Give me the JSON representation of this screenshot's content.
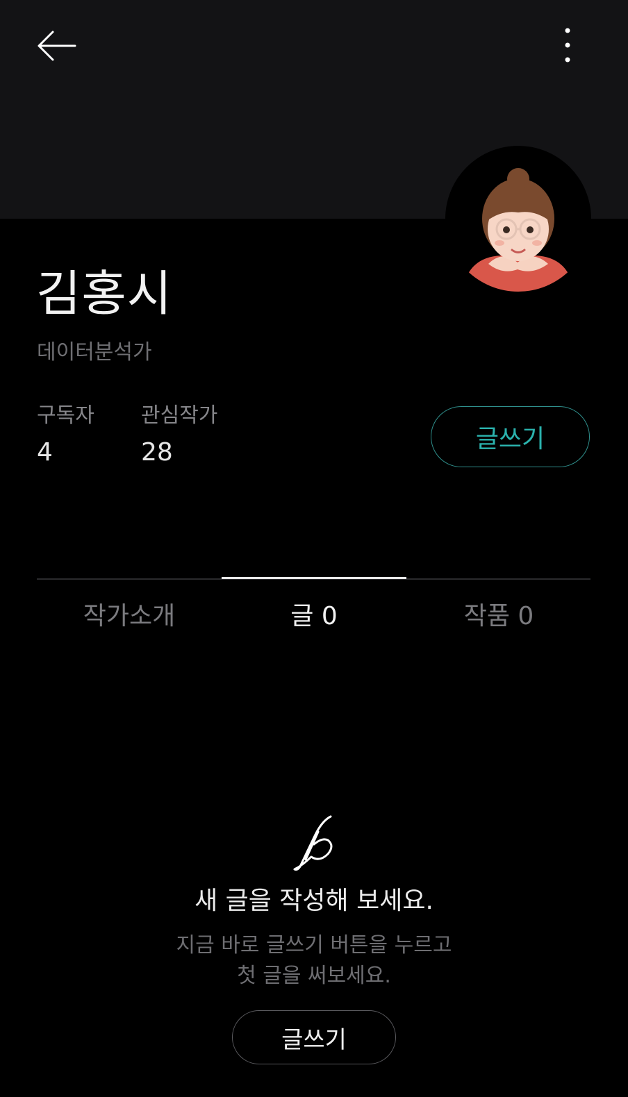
{
  "header": {
    "back_icon": "arrow-left-icon",
    "more_icon": "more-vertical-icon"
  },
  "profile": {
    "name": "김홍시",
    "job": "데이터분석가",
    "avatar_icon": "avatar-emoji",
    "stats": [
      {
        "label": "구독자",
        "value": "4"
      },
      {
        "label": "관심작가",
        "value": "28"
      }
    ],
    "write_button_label": "글쓰기"
  },
  "tabs": [
    {
      "label": "작가소개"
    },
    {
      "label": "글 0"
    },
    {
      "label": "작품 0"
    }
  ],
  "empty_state": {
    "icon": "brunch-b-logo-icon",
    "title": "새 글을 작성해 보세요.",
    "desc_line1": "지금 바로 글쓰기 버튼을 누르고",
    "desc_line2": "첫 글을 써보세요.",
    "button_label": "글쓰기"
  },
  "colors": {
    "accent": "#2bb3ae",
    "background": "#000000",
    "header_band": "#131315"
  }
}
